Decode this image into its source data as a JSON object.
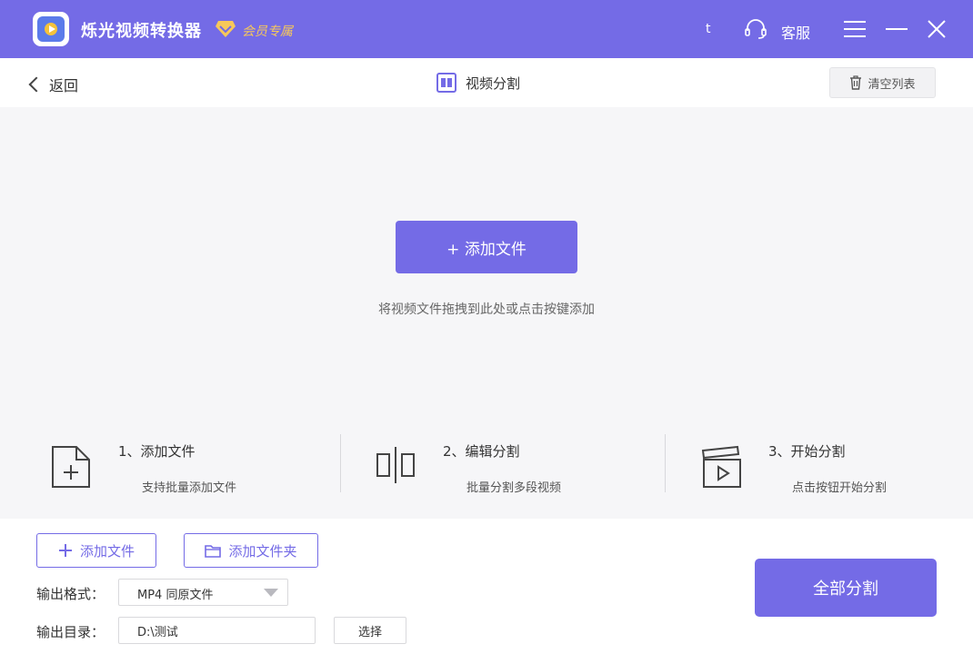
{
  "titlebar": {
    "app_name": "烁光视频转换器",
    "vip_label": "会员专属",
    "user_name": "t",
    "support_label": "客服"
  },
  "subheader": {
    "back_label": "返回",
    "title": "视频分割",
    "clear_label": "清空列表"
  },
  "droparea": {
    "add_button_label": "+ 添加文件",
    "hint": "将视频文件拖拽到此处或点击按键添加",
    "steps": [
      {
        "title": "1、添加文件",
        "desc": "支持批量添加文件",
        "icon": "file-add-icon"
      },
      {
        "title": "2、编辑分割",
        "desc": "批量分割多段视频",
        "icon": "split-icon"
      },
      {
        "title": "3、开始分割",
        "desc": "点击按钮开始分割",
        "icon": "clapper-play-icon"
      }
    ]
  },
  "bottom": {
    "add_file_label": "添加文件",
    "add_folder_label": "添加文件夹",
    "format_label": "输出格式：",
    "format_value": "MP4 同原文件",
    "dir_label": "输出目录：",
    "dir_value": "D:\\测试",
    "choose_label": "选择",
    "split_all_label": "全部分割"
  },
  "colors": {
    "accent": "#746be6",
    "vip_gold": "#f7c85a",
    "drop_bg": "#f6f6f8"
  }
}
